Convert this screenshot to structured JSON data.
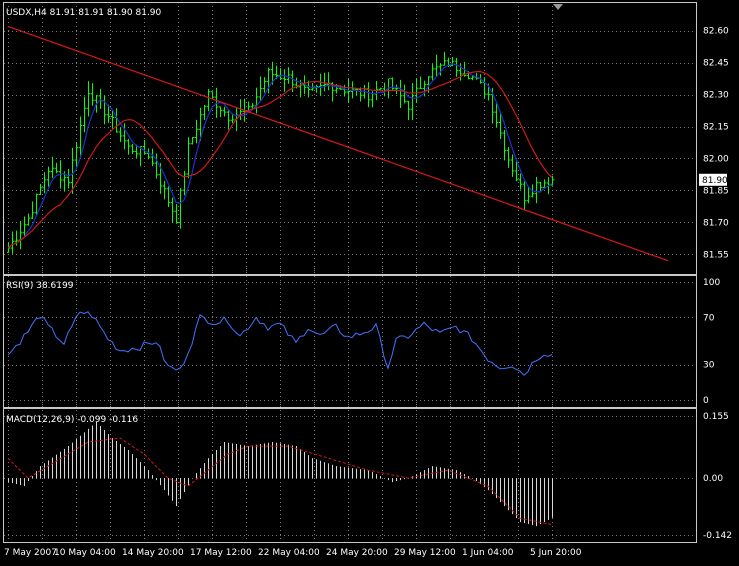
{
  "chart_data": {
    "type": "candlestick",
    "title": "USDX,H4  81.91 81.91 81.90 81.90",
    "price": {
      "ylim": [
        81.5,
        82.65
      ],
      "yticks": [
        {
          "value": 82.6,
          "label": "82.60"
        },
        {
          "value": 82.45,
          "label": "82.45"
        },
        {
          "value": 82.3,
          "label": "82.30"
        },
        {
          "value": 82.15,
          "label": "82.15"
        },
        {
          "value": 82.0,
          "label": "82.00"
        },
        {
          "value": 81.85,
          "label": "81.85"
        },
        {
          "value": 81.7,
          "label": "81.70"
        },
        {
          "value": 81.55,
          "label": "81.55"
        }
      ],
      "current_price": {
        "value": 81.9,
        "label": "81.90"
      },
      "close_anchors": [
        [
          0,
          81.58
        ],
        [
          5,
          81.72
        ],
        [
          10,
          81.95
        ],
        [
          15,
          81.9
        ],
        [
          20,
          82.32
        ],
        [
          25,
          82.2
        ],
        [
          30,
          82.05
        ],
        [
          35,
          82.02
        ],
        [
          40,
          81.8
        ],
        [
          42,
          81.72
        ],
        [
          45,
          82.05
        ],
        [
          50,
          82.3
        ],
        [
          55,
          82.2
        ],
        [
          60,
          82.22
        ],
        [
          65,
          82.4
        ],
        [
          70,
          82.38
        ],
        [
          75,
          82.3
        ],
        [
          80,
          82.35
        ],
        [
          85,
          82.32
        ],
        [
          90,
          82.3
        ],
        [
          95,
          82.35
        ],
        [
          100,
          82.25
        ],
        [
          105,
          82.4
        ],
        [
          110,
          82.45
        ],
        [
          115,
          82.4
        ],
        [
          120,
          82.3
        ],
        [
          125,
          82.0
        ],
        [
          129,
          81.82
        ],
        [
          132,
          81.88
        ],
        [
          136,
          81.9
        ]
      ],
      "trendline": {
        "from": [
          0,
          82.62
        ],
        "to": [
          165,
          81.52
        ]
      }
    },
    "rsi": {
      "label": "RSI(9) 38.6199",
      "ylim": [
        0,
        100
      ],
      "yticks": [
        {
          "value": 100,
          "label": "100"
        },
        {
          "value": 70,
          "label": "70"
        },
        {
          "value": 30,
          "label": "30"
        },
        {
          "value": 0,
          "label": "0"
        }
      ],
      "anchors": [
        [
          0,
          38
        ],
        [
          5,
          58
        ],
        [
          8,
          72
        ],
        [
          10,
          62
        ],
        [
          14,
          48
        ],
        [
          18,
          75
        ],
        [
          21,
          72
        ],
        [
          25,
          52
        ],
        [
          28,
          42
        ],
        [
          33,
          45
        ],
        [
          37,
          50
        ],
        [
          40,
          28
        ],
        [
          43,
          25
        ],
        [
          46,
          50
        ],
        [
          48,
          70
        ],
        [
          52,
          66
        ],
        [
          55,
          68
        ],
        [
          58,
          54
        ],
        [
          62,
          70
        ],
        [
          65,
          62
        ],
        [
          68,
          64
        ],
        [
          72,
          48
        ],
        [
          75,
          62
        ],
        [
          78,
          54
        ],
        [
          82,
          62
        ],
        [
          85,
          53
        ],
        [
          88,
          56
        ],
        [
          92,
          62
        ],
        [
          95,
          28
        ],
        [
          97,
          50
        ],
        [
          100,
          54
        ],
        [
          104,
          64
        ],
        [
          108,
          56
        ],
        [
          112,
          62
        ],
        [
          116,
          52
        ],
        [
          120,
          35
        ],
        [
          123,
          28
        ],
        [
          126,
          30
        ],
        [
          129,
          22
        ],
        [
          132,
          35
        ],
        [
          134,
          40
        ],
        [
          136,
          38.6
        ]
      ]
    },
    "macd": {
      "label": "MACD(12,26,9) -0.099 -0.116",
      "ylim": [
        -0.142,
        0.155
      ],
      "yticks": [
        {
          "value": 0.155,
          "label": "0.155"
        },
        {
          "value": 0.0,
          "label": "0.00"
        },
        {
          "value": -0.142,
          "label": "-0.142"
        }
      ],
      "hist_anchors": [
        [
          0,
          -0.01
        ],
        [
          4,
          -0.02
        ],
        [
          8,
          0.03
        ],
        [
          15,
          0.08
        ],
        [
          22,
          0.14
        ],
        [
          26,
          0.1
        ],
        [
          30,
          0.07
        ],
        [
          35,
          0.02
        ],
        [
          39,
          -0.03
        ],
        [
          42,
          -0.07
        ],
        [
          46,
          0.0
        ],
        [
          50,
          0.05
        ],
        [
          54,
          0.09
        ],
        [
          60,
          0.08
        ],
        [
          66,
          0.09
        ],
        [
          72,
          0.08
        ],
        [
          76,
          0.05
        ],
        [
          82,
          0.03
        ],
        [
          90,
          0.02
        ],
        [
          96,
          -0.01
        ],
        [
          100,
          0.0
        ],
        [
          106,
          0.03
        ],
        [
          112,
          0.02
        ],
        [
          116,
          0.0
        ],
        [
          120,
          -0.03
        ],
        [
          124,
          -0.07
        ],
        [
          128,
          -0.11
        ],
        [
          132,
          -0.12
        ],
        [
          136,
          -0.099
        ]
      ],
      "signal_anchors": [
        [
          0,
          0.05
        ],
        [
          5,
          0.0
        ],
        [
          10,
          0.03
        ],
        [
          20,
          0.09
        ],
        [
          28,
          0.1
        ],
        [
          34,
          0.06
        ],
        [
          40,
          0.0
        ],
        [
          45,
          -0.02
        ],
        [
          50,
          0.02
        ],
        [
          55,
          0.06
        ],
        [
          60,
          0.08
        ],
        [
          70,
          0.08
        ],
        [
          80,
          0.05
        ],
        [
          90,
          0.02
        ],
        [
          100,
          0.0
        ],
        [
          110,
          0.02
        ],
        [
          120,
          -0.02
        ],
        [
          128,
          -0.1
        ],
        [
          136,
          -0.116
        ]
      ]
    },
    "x": {
      "bar_count": 137,
      "ticks": [
        {
          "bar": 0,
          "label": "7 May 2007"
        },
        {
          "bar": 17,
          "label": "10 May 04:00"
        },
        {
          "bar": 34,
          "label": "14 May 20:00"
        },
        {
          "bar": 51,
          "label": "17 May 12:00"
        },
        {
          "bar": 68,
          "label": "22 May 04:00"
        },
        {
          "bar": 85,
          "label": "24 May 20:00"
        },
        {
          "bar": 102,
          "label": "29 May 12:00"
        },
        {
          "bar": 119,
          "label": "1 Jun 04:00"
        },
        {
          "bar": 136,
          "label": "5 Jun 20:00"
        }
      ]
    },
    "colors": {
      "background": "#000000",
      "candles": "#00ff00",
      "ma_fast": "#1f2fd6",
      "ma_slow": "#d01818",
      "trendline": "#d81818",
      "rsi_line": "#4472ff",
      "macd_hist": "#d8d8d8",
      "macd_signal": "#d01818",
      "grid": "#7a7a7a",
      "text": "#ffffff",
      "price_tag_bg": "#ffffff",
      "price_tag_text": "#000000"
    },
    "grid": true
  }
}
